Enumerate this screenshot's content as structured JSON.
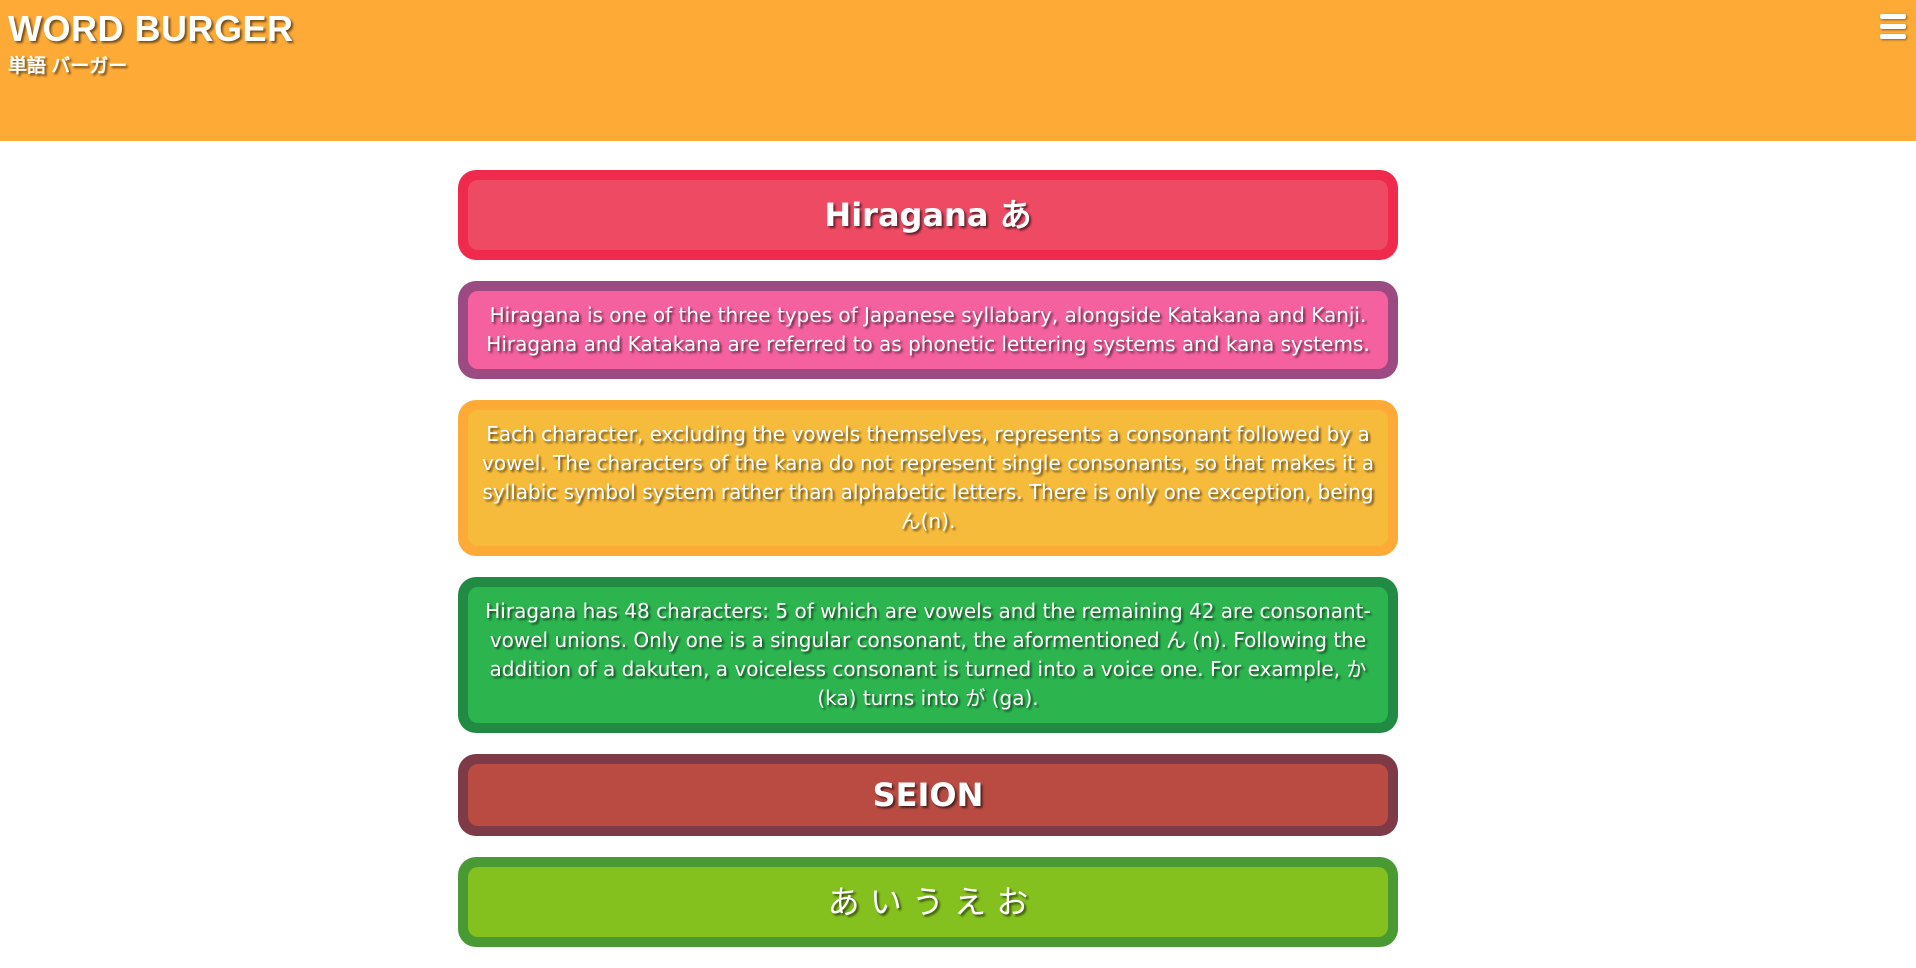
{
  "header": {
    "title": "WORD BURGER",
    "subtitle": "単語 バーガー",
    "menu_icon": "hamburger-menu-icon",
    "background": "#fdaa37"
  },
  "main": {
    "heading": "Hiragana あ",
    "paragraphs": [
      "Hiragana is one of the three types of Japanese syllabary, alongside Katakana and Kanji. Hiragana and Katakana are referred to as phonetic lettering systems and kana systems.",
      "Each character, excluding the vowels themselves, represents a consonant followed by a vowel. The characters of the kana do not represent single consonants, so that makes it a syllabic symbol system rather than alphabetic letters. There is only one exception, being ん(n).",
      "Hiragana has 48 characters: 5 of which are vowels and the remaining 42 are consonant-vowel unions. Only one is a singular consonant, the aformentioned ん (n). Following the addition of a dakuten, a voiceless consonant is turned into a voice one. For example, か (ka) turns into が (ga)."
    ],
    "section_heading": "SEION",
    "vowel_row": "あ い う え お"
  },
  "colors": {
    "red": "#f02a4c",
    "pink": "#f5609f",
    "orange": "#f7bb3c",
    "green": "#2cb54f",
    "maroon": "#b94b43",
    "lime": "#84c11e"
  }
}
